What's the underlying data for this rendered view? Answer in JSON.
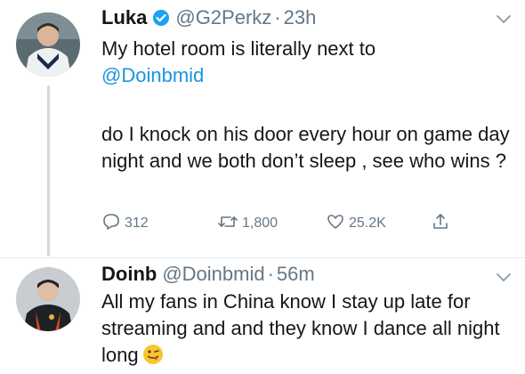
{
  "tweets": [
    {
      "name": "Luka",
      "verified": true,
      "handle": "@G2Perkz",
      "separator": "·",
      "time": "23h",
      "text_line1": "My hotel room is literally next to",
      "mention": "@Doinbmid",
      "text_body": "do I knock on his door every hour on game day night and we both don’t sleep , see who wins ?",
      "stats": {
        "replies": "312",
        "retweets": "1,800",
        "likes": "25.2K"
      }
    },
    {
      "name": "Doinb",
      "handle": "@Doinbmid",
      "separator": "·",
      "time": "56m",
      "text": "All my fans in China know I stay up late for streaming and and they know I dance all night long",
      "emoji": "winking-tongue-face"
    }
  ],
  "colors": {
    "link": "#1b95e0",
    "secondary": "#657786",
    "verified": "#1da1f2",
    "thread_line": "#cfd9de"
  },
  "icons": [
    "verified-badge-icon",
    "chevron-down-icon",
    "reply-icon",
    "retweet-icon",
    "like-icon",
    "share-icon"
  ]
}
